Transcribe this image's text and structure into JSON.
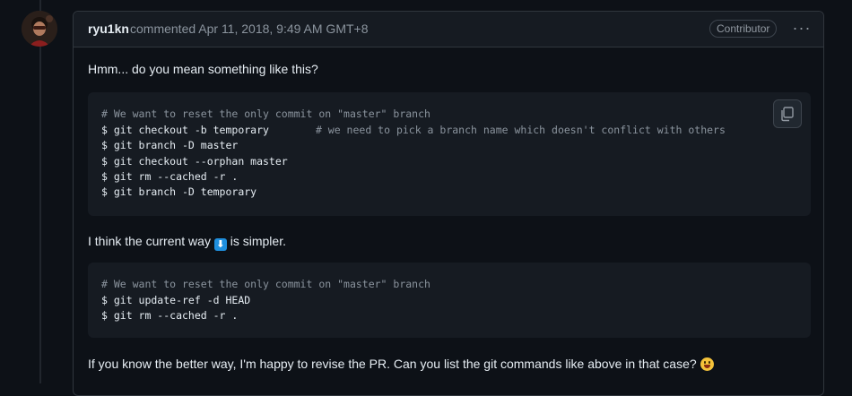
{
  "comment": {
    "author": "ryu1kn",
    "meta": "commented Apr 11, 2018, 9:49 AM GMT+8",
    "badge": "Contributor",
    "more_label": "···",
    "paragraph1": "Hmm... do you mean something like this?",
    "code1": {
      "lines": [
        "# We want to reset the only commit on \"master\" branch",
        "$ git checkout -b temporary",
        "$ git branch -D master",
        "$ git checkout --orphan master",
        "$ git rm --cached -r .",
        "$ git branch -D temporary"
      ],
      "inline_comment": "# we need to pick a branch name which doesn't conflict with others"
    },
    "paragraph2_before": "I think the current way",
    "paragraph2_emoji": "⬇",
    "paragraph2_after": "is simpler.",
    "code2": {
      "lines": [
        "# We want to reset the only commit on \"master\" branch",
        "$ git update-ref -d HEAD",
        "$ git rm --cached -r ."
      ]
    },
    "paragraph3": "If you know the better way, I'm happy to revise the PR. Can you list the git commands like above in that case?"
  },
  "icons": {
    "copy": "copy-icon",
    "down_arrow": "arrow-down-emoji",
    "smile": "grinning-face-emoji"
  }
}
